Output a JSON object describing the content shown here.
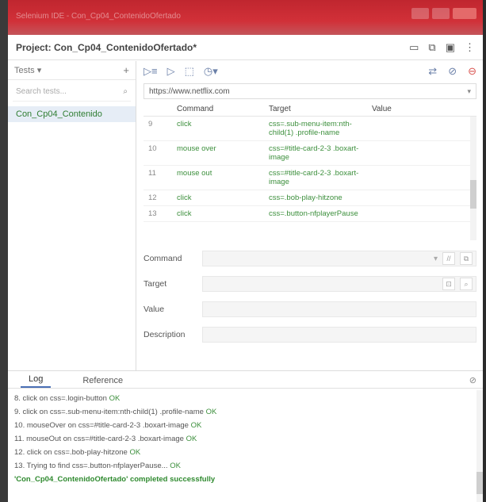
{
  "window": {
    "title": "Selenium IDE - Con_Cp04_ContenidoOfertado"
  },
  "project": {
    "title": "Project: Con_Cp04_ContenidoOfertado*"
  },
  "sidebar": {
    "dropdown": "Tests ▾",
    "search_placeholder": "Search tests...",
    "items": [
      {
        "label": "Con_Cp04_Contenido"
      }
    ]
  },
  "url": {
    "value": "https://www.netflix.com"
  },
  "table": {
    "headers": [
      "Command",
      "Target",
      "Value"
    ],
    "rows": [
      {
        "num": "9",
        "command": "click",
        "target": "css=.sub-menu-item:nth-child(1) .profile-name",
        "value": ""
      },
      {
        "num": "10",
        "command": "mouse over",
        "target": "css=#title-card-2-3 .boxart-image",
        "value": ""
      },
      {
        "num": "11",
        "command": "mouse out",
        "target": "css=#title-card-2-3 .boxart-image",
        "value": ""
      },
      {
        "num": "12",
        "command": "click",
        "target": "css=.bob-play-hitzone",
        "value": ""
      },
      {
        "num": "13",
        "command": "click",
        "target": "css=.button-nfplayerPause",
        "value": ""
      }
    ]
  },
  "editor": {
    "command_label": "Command",
    "target_label": "Target",
    "value_label": "Value",
    "description_label": "Description"
  },
  "log": {
    "tabs": [
      "Log",
      "Reference"
    ],
    "lines": [
      {
        "text": "8.  click on css=.login-button",
        "status": "OK"
      },
      {
        "text": "9.  click on css=.sub-menu-item:nth-child(1) .profile-name",
        "status": "OK"
      },
      {
        "text": "10.  mouseOver on css=#title-card-2-3 .boxart-image",
        "status": "OK"
      },
      {
        "text": "11.  mouseOut on css=#title-card-2-3 .boxart-image",
        "status": "OK"
      },
      {
        "text": "12.  click on css=.bob-play-hitzone",
        "status": "OK"
      },
      {
        "text": "13.  Trying to find css=.button-nfplayerPause...",
        "status": "OK"
      }
    ],
    "completed": "'Con_Cp04_ContenidoOfertado' completed successfully"
  }
}
